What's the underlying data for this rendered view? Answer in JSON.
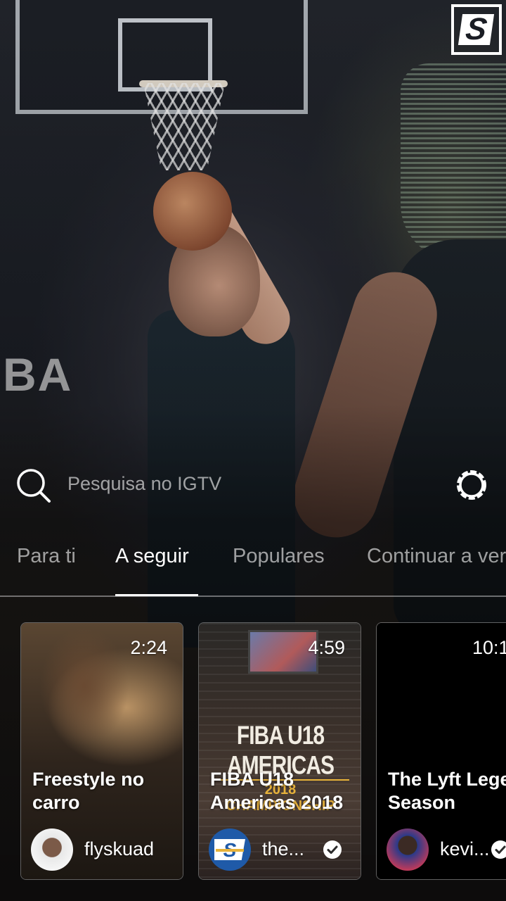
{
  "brand": {
    "logo_letter": "S"
  },
  "background": {
    "wall_text": "BA"
  },
  "search": {
    "placeholder": "Pesquisa no IGTV"
  },
  "tabs": [
    {
      "label": "Para ti",
      "active": false
    },
    {
      "label": "A seguir",
      "active": true
    },
    {
      "label": "Populares",
      "active": false
    },
    {
      "label": "Continuar a ver",
      "active": false
    }
  ],
  "cards": [
    {
      "duration": "2:24",
      "title": "Freestyle no carro",
      "username": "flyskuad",
      "verified": false
    },
    {
      "duration": "4:59",
      "title": "FIBA U18 Americas 2018",
      "username": "the...",
      "verified": true,
      "thumbnail_text": {
        "line1": "FIBA U18 AMERICAS",
        "line2": "2018 CHAMPIONSHIP"
      }
    },
    {
      "duration": "10:1",
      "title": "The Lyft Legend Season",
      "username": "kevi...",
      "verified": true
    }
  ],
  "colors": {
    "accent_gold": "#e7b23a",
    "text_primary": "#ffffff",
    "text_secondary": "rgba(255,255,255,0.6)"
  }
}
